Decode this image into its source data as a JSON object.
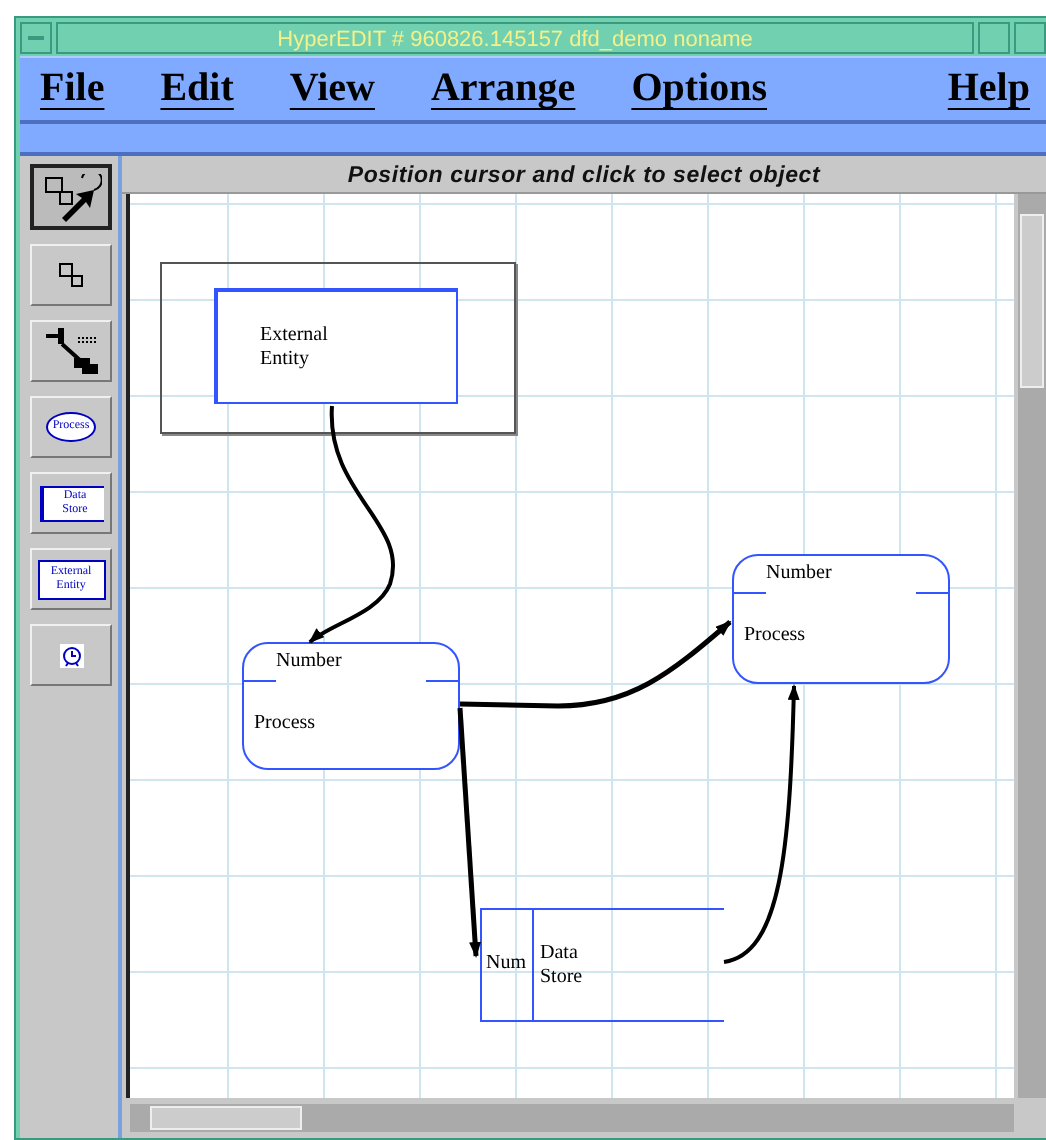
{
  "window": {
    "title": "HyperEDIT # 960826.145157 dfd_demo noname"
  },
  "menu": [
    {
      "label": "File"
    },
    {
      "label": "Edit"
    },
    {
      "label": "View"
    },
    {
      "label": "Arrange"
    },
    {
      "label": "Options"
    },
    {
      "label": "Help"
    }
  ],
  "status": "Position cursor and click to select object",
  "tools": [
    {
      "kind": "select",
      "selected": true
    },
    {
      "kind": "resize",
      "selected": false
    },
    {
      "kind": "connect",
      "selected": false
    },
    {
      "kind": "process",
      "label": "Process",
      "selected": false
    },
    {
      "kind": "datastore",
      "label": "Data Store",
      "selected": false
    },
    {
      "kind": "entity",
      "label": "External Entity",
      "selected": false
    },
    {
      "kind": "clock",
      "selected": false
    }
  ],
  "nodes": [
    {
      "kind": "external_entity",
      "label": "External Entity",
      "selected": true
    },
    {
      "kind": "process",
      "number": "Number",
      "label": "Process"
    },
    {
      "kind": "process",
      "number": "Number",
      "label": "Process"
    },
    {
      "kind": "data_store",
      "number": "Num",
      "label": "Data Store"
    }
  ]
}
